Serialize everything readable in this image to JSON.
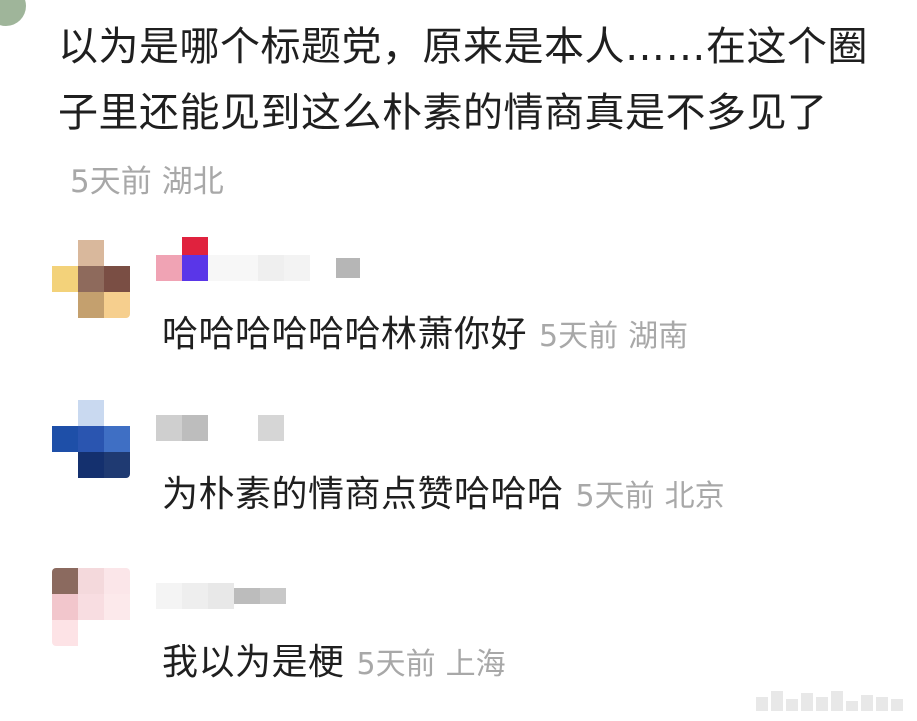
{
  "main_comment": {
    "text": "以为是哪个标题党，原来是本人……在这个圈子里还能见到这么朴素的情商真是不多见了",
    "time": "5天前",
    "location": "湖北"
  },
  "replies": [
    {
      "text": "哈哈哈哈哈哈林萧你好",
      "time": "5天前",
      "location": "湖南"
    },
    {
      "text": "为朴素的情商点赞哈哈哈",
      "time": "5天前",
      "location": "北京"
    },
    {
      "text": "我以为是梗",
      "time": "5天前",
      "location": "上海"
    }
  ],
  "colors": {
    "text": "#1f1f1f",
    "meta": "#a8a8a8",
    "background": "#ffffff"
  }
}
